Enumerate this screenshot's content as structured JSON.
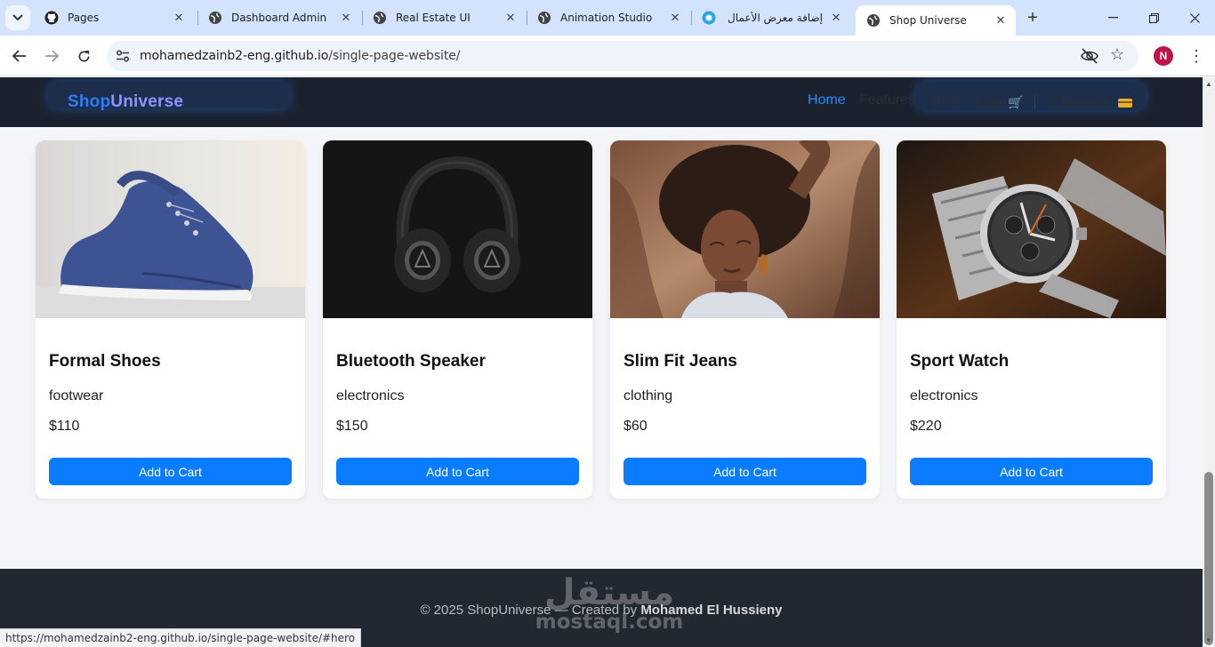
{
  "browser": {
    "tabs": [
      {
        "title": "Pages",
        "icon": "github-icon"
      },
      {
        "title": "Dashboard Admin",
        "icon": "globe-icon"
      },
      {
        "title": "Real Estate UI",
        "icon": "globe-icon"
      },
      {
        "title": "Animation Studio",
        "icon": "globe-icon"
      },
      {
        "title": "إضافة معرض الأعمال",
        "icon": "mostaql-icon"
      },
      {
        "title": "Shop Universe",
        "icon": "globe-icon",
        "active": true
      }
    ],
    "url_host": "mohamedzainb2-eng.github.io",
    "url_path": "/single-page-website/",
    "profile_initial": "N",
    "status_url": "https://mohamedzainb2-eng.github.io/single-page-website/#hero"
  },
  "site": {
    "brand_part1": "Shop",
    "brand_part2": "Universe",
    "nav": {
      "home": "Home",
      "features": "Features",
      "shop": "Shop",
      "cart": "Cart",
      "checkout": "Checkout"
    },
    "colors": {
      "accent": "#0a7cff",
      "header_bg": "#1c222d",
      "footer_bg": "#222831"
    }
  },
  "products": [
    {
      "name": "Formal Shoes",
      "category": "footwear",
      "price": "$110",
      "button": "Add to Cart",
      "image": "blue-sneaker"
    },
    {
      "name": "Bluetooth Speaker",
      "category": "electronics",
      "price": "$150",
      "button": "Add to Cart",
      "image": "black-headphones"
    },
    {
      "name": "Slim Fit Jeans",
      "category": "clothing",
      "price": "$60",
      "button": "Add to Cart",
      "image": "woman-portrait"
    },
    {
      "name": "Sport Watch",
      "category": "electronics",
      "price": "$220",
      "button": "Add to Cart",
      "image": "silver-wristwatch"
    }
  ],
  "footer": {
    "copyright": "© 2025 ShopUniverse — Created by ",
    "author": "Mohamed El Hussieny"
  },
  "watermark": {
    "arabic": "مستقل",
    "latin": "mostaql.com"
  }
}
